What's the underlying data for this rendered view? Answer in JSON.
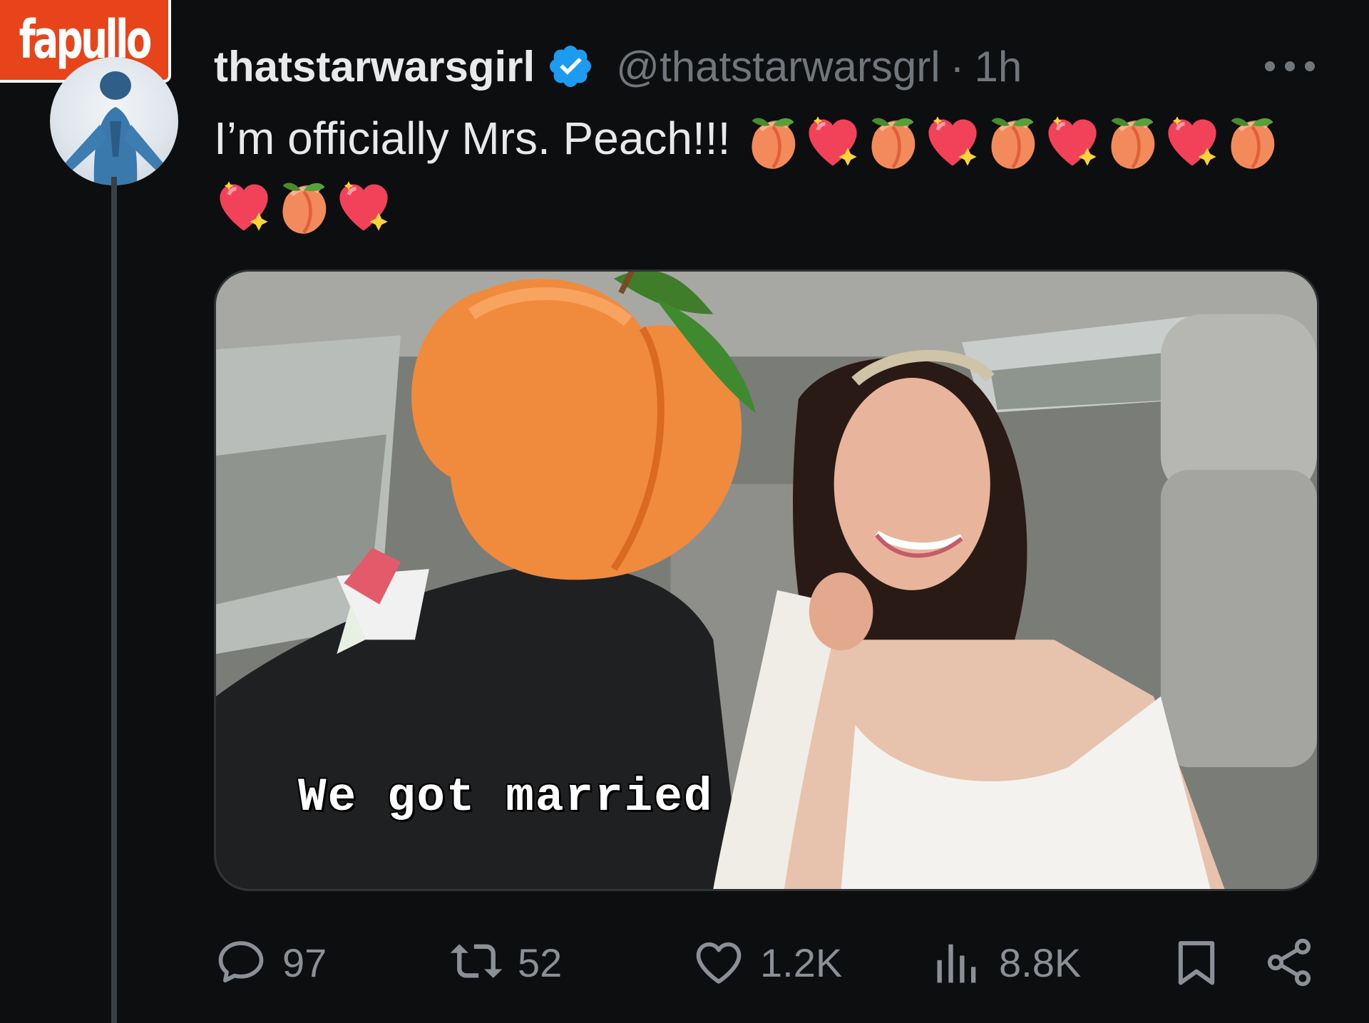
{
  "watermark": {
    "text": "fapullo"
  },
  "post": {
    "display_name": "thatstarwarsgirl",
    "verified": true,
    "handle": "@thatstarwarsgrl",
    "separator": "·",
    "time": "1h",
    "text": "I’m officially Mrs. Peach!!!",
    "emoji_sequence": [
      "peach",
      "sparkling-heart",
      "peach",
      "sparkling-heart",
      "peach",
      "sparkling-heart",
      "peach",
      "sparkling-heart",
      "peach",
      "sparkling-heart",
      "peach",
      "sparkling-heart"
    ],
    "media": {
      "caption": "We got married",
      "description_icons": [
        "peach-emoji-overlay"
      ]
    }
  },
  "actions": {
    "replies": "97",
    "reposts": "52",
    "likes": "1.2K",
    "views": "8.8K"
  },
  "colors": {
    "background": "#0d0e10",
    "text": "#e7e9ea",
    "muted": "#71767b",
    "verified": "#1d9bf0",
    "watermark": "#e8441c"
  }
}
